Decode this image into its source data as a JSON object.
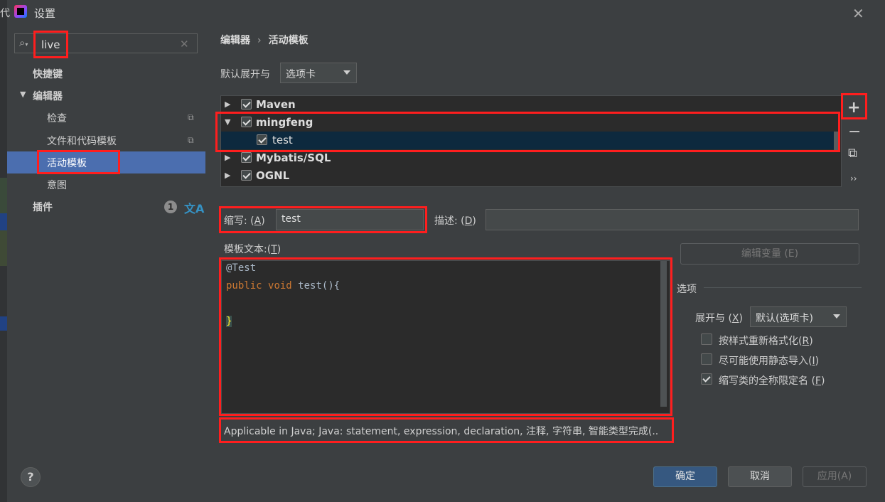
{
  "window": {
    "title": "设置",
    "partial_left_text": "代"
  },
  "search": {
    "value": "live"
  },
  "sidebar": {
    "items": [
      {
        "label": "快捷键"
      },
      {
        "label": "编辑器"
      },
      {
        "label": "检查"
      },
      {
        "label": "文件和代码模板"
      },
      {
        "label": "活动模板"
      },
      {
        "label": "意图"
      },
      {
        "label": "插件"
      }
    ],
    "plugins_badge": "1"
  },
  "breadcrumb": {
    "parent": "编辑器",
    "separator": "›",
    "current": "活动模板"
  },
  "expand_default": {
    "label": "默认展开与",
    "value": "选项卡"
  },
  "template_tree": {
    "groups": [
      {
        "name": "Maven",
        "checked": true,
        "expanded": false
      },
      {
        "name": "mingfeng",
        "checked": true,
        "expanded": true
      },
      {
        "name": "test",
        "checked": true,
        "child": true,
        "selected": true
      },
      {
        "name": "Mybatis/SQL",
        "checked": true,
        "expanded": false
      },
      {
        "name": "OGNL",
        "checked": true,
        "expanded": false
      }
    ],
    "tools": [
      "+",
      "−",
      "⧉",
      "››"
    ]
  },
  "abbreviation": {
    "label": "缩写: ",
    "mnemonic": "A",
    "value": "test"
  },
  "description": {
    "label": "描述: ",
    "mnemonic": "D",
    "value": ""
  },
  "template_text": {
    "label": "模板文本:",
    "mnemonic": "T",
    "lines": [
      "@Test",
      "public",
      "void",
      "test(){",
      "}"
    ]
  },
  "edit_variables_button": "编辑变量 (E)",
  "options": {
    "heading": "选项",
    "expand_with_label": "展开与 ",
    "expand_with_mnemonic": "X",
    "expand_with_value": "默认(选项卡)",
    "reformat": {
      "label": "按样式重新格式化",
      "mnemonic": "R",
      "checked": false
    },
    "static_import": {
      "label": "尽可能使用静态导入",
      "mnemonic": "I",
      "checked": false
    },
    "shorten_fq": {
      "label": "缩写类的全称限定名 ",
      "mnemonic": "F",
      "checked": true
    }
  },
  "applicable_context": "Applicable in Java; Java: statement, expression, declaration, 注释, 字符串, 智能类型完成(..",
  "footer": {
    "help": "?",
    "ok": "确定",
    "cancel": "取消",
    "apply": "应用(A)"
  },
  "colors": {
    "highlight_box": "#ff1e1e",
    "selection": "#4b6eaf",
    "keyword": "#cc7832"
  }
}
